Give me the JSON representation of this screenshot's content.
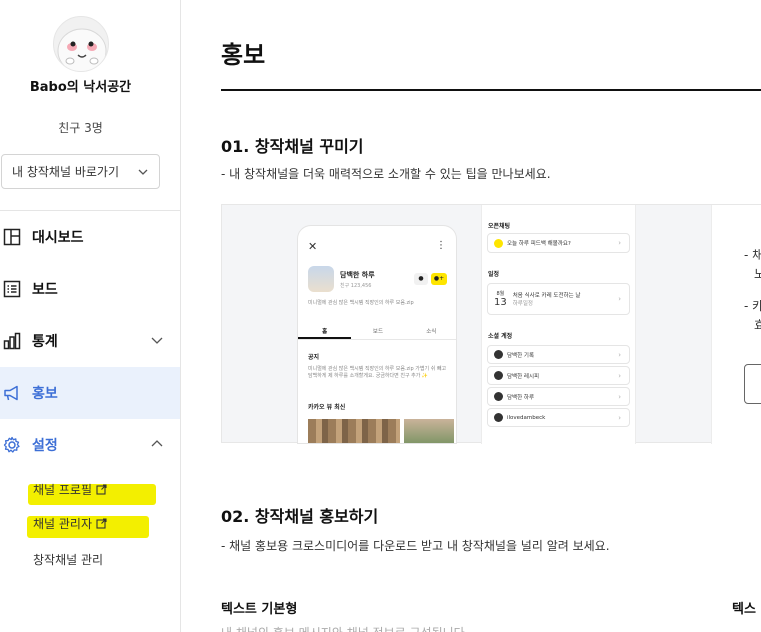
{
  "sidebar": {
    "profile_name": "Babo의 낙서공간",
    "friends": "친구 3명",
    "shortcut_label": "내 창작채널 바로가기",
    "nav": {
      "dashboard": "대시보드",
      "board": "보드",
      "stats": "통계",
      "promo": "홍보",
      "settings": "설정"
    },
    "sub": {
      "profile": "채널 프로필",
      "manager": "채널 관리자",
      "channel_manage": "창작채널 관리"
    },
    "highlight_color": "#f3ef00",
    "active_color": "#3d6fd6"
  },
  "main": {
    "title": "홍보",
    "section1": {
      "title": "01. 창작채널 꾸미기",
      "desc": "- 내 창작채널을 더욱 매력적으로 소개할 수 있는 팁을 만나보세요."
    },
    "section2": {
      "title": "02. 창작채널 홍보하기",
      "desc": "- 채널 홍보용 크로스미디어를 다운로드 받고 내 창작채널을 널리 알려 보세요."
    },
    "text_basic": {
      "title": "텍스트 기본형",
      "desc": "내 채널의 홍보 메시지와 채널 정보로 구성됩니다."
    },
    "text_right_title": "텍스",
    "right_pane": {
      "line1": "- 채",
      "line2": "노",
      "line3": "- 카",
      "line4": "효"
    }
  },
  "preview": {
    "phone": {
      "close": "✕",
      "more": "⋮",
      "name": "담백한 하루",
      "sub": "친구 123,456",
      "intro": "미니멀에 관심 많은 백시템 직장인의 하루 모음.zip",
      "tabs": [
        "홈",
        "보드",
        "소식"
      ],
      "notice_title": "공지",
      "notice_text": "미니멀에 관심 많은 백시템 직장인의 하루 모음.zip 가볍기 쉬 빼고 담백하게 제 하루를 소개할게요. 궁금하다면 친구 추가 ✨",
      "news_title": "카카오 뷰 최신"
    },
    "card": {
      "open_chat_label": "오픈채팅",
      "open_chat_text": "오늘 하루 피드백 해볼까요?",
      "schedule_label": "일정",
      "schedule_month": "8월",
      "schedule_day": "13",
      "schedule_text": "처음 식사로 카레 도전하는 날",
      "schedule_sub": "하루일정",
      "social_label": "소셜 계정",
      "social": [
        "담백한 기록",
        "담백한 레시피",
        "담백한 하루",
        "ilovedambeck"
      ]
    }
  }
}
